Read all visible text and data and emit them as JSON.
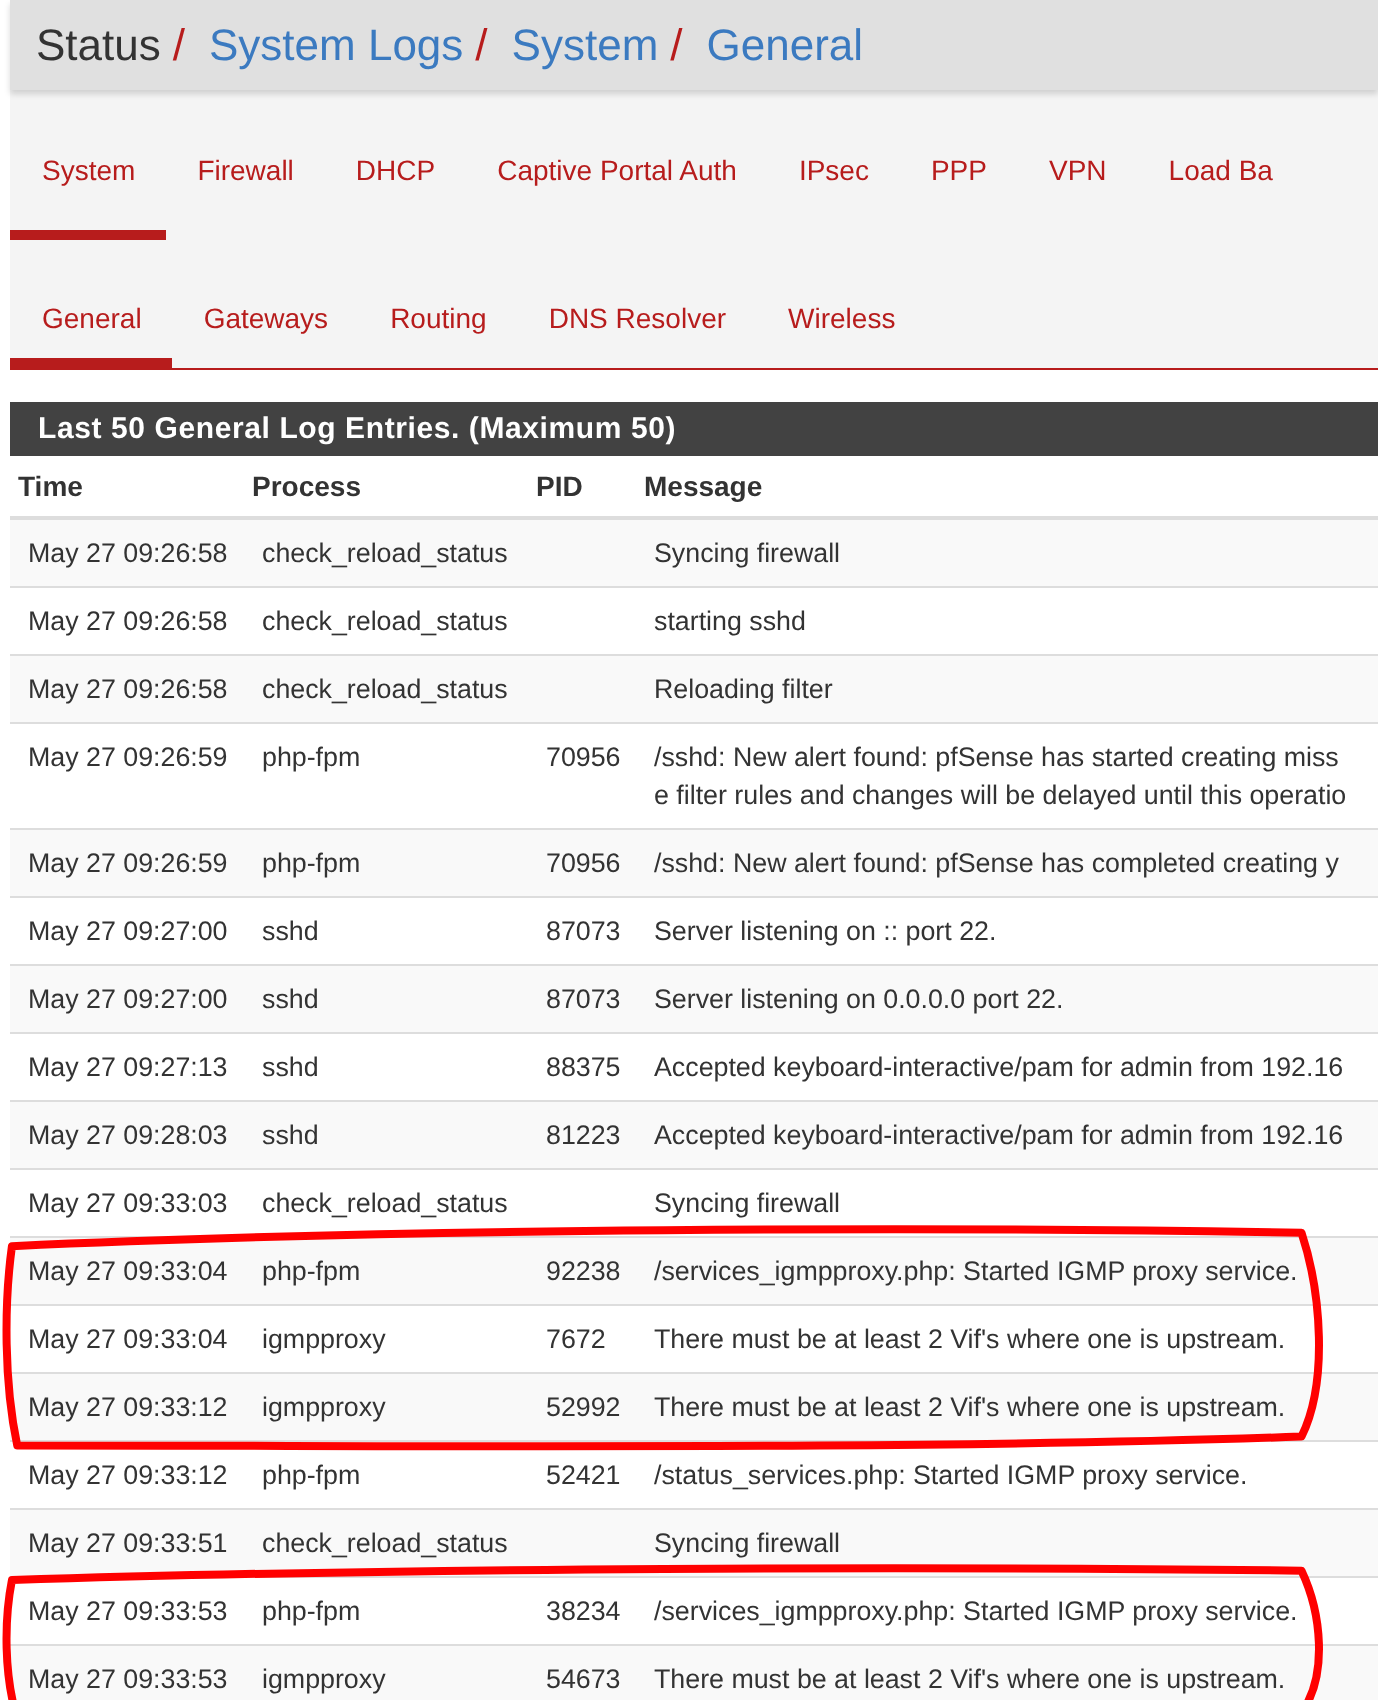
{
  "breadcrumb": [
    {
      "text": "Status",
      "kind": "plain",
      "separator_after": "/"
    },
    {
      "text": "System Logs",
      "kind": "link",
      "separator_after": "/"
    },
    {
      "text": "System",
      "kind": "link",
      "separator_after": "/"
    },
    {
      "text": "General",
      "kind": "link"
    }
  ],
  "tabs": [
    {
      "label": "System",
      "selected": true
    },
    {
      "label": "Firewall",
      "selected": false
    },
    {
      "label": "DHCP",
      "selected": false
    },
    {
      "label": "Captive Portal Auth",
      "selected": false
    },
    {
      "label": "IPsec",
      "selected": false
    },
    {
      "label": "PPP",
      "selected": false
    },
    {
      "label": "VPN",
      "selected": false
    },
    {
      "label": "Load Ba",
      "selected": false
    }
  ],
  "subtabs": [
    {
      "label": "General",
      "selected": true
    },
    {
      "label": "Gateways",
      "selected": false
    },
    {
      "label": "Routing",
      "selected": false
    },
    {
      "label": "DNS Resolver",
      "selected": false
    },
    {
      "label": "Wireless",
      "selected": false
    }
  ],
  "log_panel": {
    "title": "Last 50 General Log Entries. (Maximum 50)",
    "columns": [
      "Time",
      "Process",
      "PID",
      "Message"
    ],
    "rows": [
      {
        "time": "May 27 09:26:58",
        "process": "check_reload_status",
        "message": [
          "Syncing firewall"
        ],
        "circled": false
      },
      {
        "time": "May 27 09:26:58",
        "process": "check_reload_status",
        "message": [
          "starting sshd"
        ],
        "circled": false
      },
      {
        "time": "May 27 09:26:58",
        "process": "check_reload_status",
        "message": [
          "Reloading filter"
        ],
        "circled": false
      },
      {
        "time": "May 27 09:26:59",
        "process": "php-fpm",
        "pid": "70956",
        "message": [
          "/sshd: New alert found: pfSense has started creating miss",
          "e filter rules and changes will be delayed until this operatio"
        ],
        "circled": false
      },
      {
        "time": "May 27 09:26:59",
        "process": "php-fpm",
        "pid": "70956",
        "message": [
          "/sshd: New alert found: pfSense has completed creating y"
        ],
        "circled": false
      },
      {
        "time": "May 27 09:27:00",
        "process": "sshd",
        "pid": "87073",
        "message": [
          "Server listening on :: port 22."
        ],
        "circled": false
      },
      {
        "time": "May 27 09:27:00",
        "process": "sshd",
        "pid": "87073",
        "message": [
          "Server listening on 0.0.0.0 port 22."
        ],
        "circled": false
      },
      {
        "time": "May 27 09:27:13",
        "process": "sshd",
        "pid": "88375",
        "message": [
          "Accepted keyboard-interactive/pam for admin from 192.16"
        ],
        "circled": false
      },
      {
        "time": "May 27 09:28:03",
        "process": "sshd",
        "pid": "81223",
        "message": [
          "Accepted keyboard-interactive/pam for admin from 192.16"
        ],
        "circled": false
      },
      {
        "time": "May 27 09:33:03",
        "process": "check_reload_status",
        "message": [
          "Syncing firewall"
        ],
        "circled": false
      },
      {
        "time": "May 27 09:33:04",
        "process": "php-fpm",
        "pid": "92238",
        "message": [
          "/services_igmpproxy.php: Started IGMP proxy service."
        ],
        "circled": true
      },
      {
        "time": "May 27 09:33:04",
        "process": "igmpproxy",
        "pid": "7672",
        "message": [
          "There must be at least 2 Vif's where one is upstream."
        ],
        "circled": true
      },
      {
        "time": "May 27 09:33:12",
        "process": "igmpproxy",
        "pid": "52992",
        "message": [
          "There must be at least 2 Vif's where one is upstream."
        ],
        "circled": true
      },
      {
        "time": "May 27 09:33:12",
        "process": "php-fpm",
        "pid": "52421",
        "message": [
          "/status_services.php: Started IGMP proxy service."
        ],
        "circled": false
      },
      {
        "time": "May 27 09:33:51",
        "process": "check_reload_status",
        "message": [
          "Syncing firewall"
        ],
        "circled": false
      },
      {
        "time": "May 27 09:33:53",
        "process": "php-fpm",
        "pid": "38234",
        "message": [
          "/services_igmpproxy.php: Started IGMP proxy service."
        ],
        "circled": true
      },
      {
        "time": "May 27 09:33:53",
        "process": "igmpproxy",
        "pid": "54673",
        "message": [
          "There must be at least 2 Vif's where one is upstream."
        ],
        "circled": true
      }
    ]
  }
}
